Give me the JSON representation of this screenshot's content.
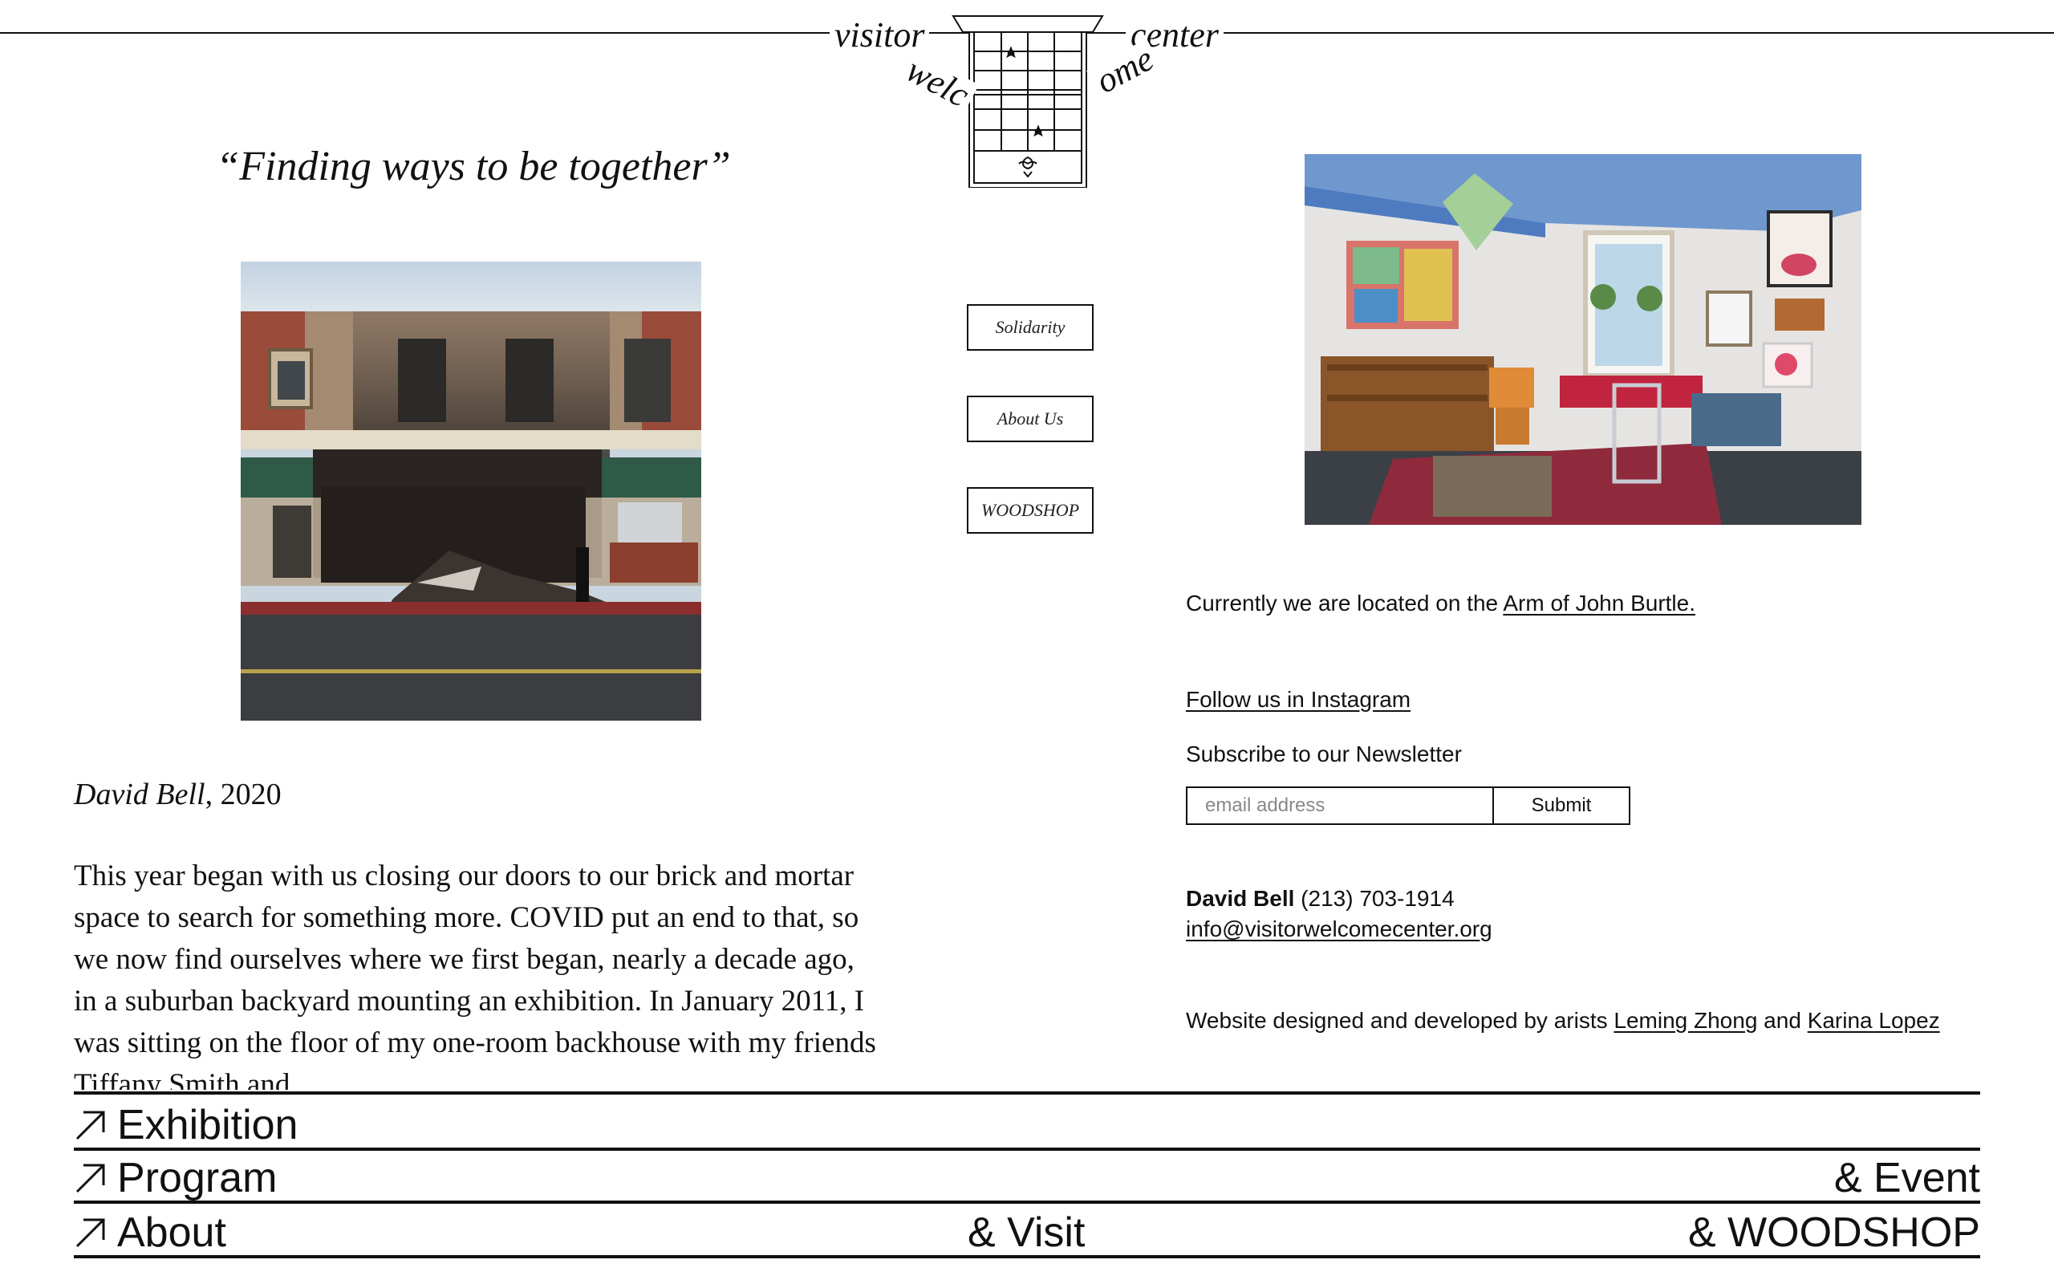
{
  "logo": {
    "word_visitor": "visitor",
    "word_welc": "welc",
    "word_ome": "ome",
    "word_center": "center"
  },
  "left": {
    "quote": "“Finding ways to be together”",
    "caption_name": "David Bell",
    "caption_year": ", 2020",
    "story": "This year began with us closing our doors to our brick and mortar space to search for something more. COVID put an end to that, so we now find ourselves where we first began, nearly a decade ago, in a suburban backyard mounting an exhibition. In January 2011, I was sitting on the floor of my one-room backhouse with my friends Tiffany Smith and"
  },
  "nav_buttons": {
    "solidarity": "Solidarity",
    "about_us": "About Us",
    "woodshop": "WOODSHOP"
  },
  "right": {
    "location_prefix": "Currently we are located on the ",
    "location_link": "Arm of John Burtle.",
    "instagram_link": "Follow us in Instagram",
    "subscribe_label": "Subscribe to our Newsletter",
    "email_placeholder": "email address",
    "submit_label": "Submit",
    "contact_name": "David Bell",
    "contact_phone": " (213) 703-1914",
    "contact_email": "info@visitorwelcomecenter.org",
    "credits_prefix": "Website designed and developed by arists ",
    "designer_1": "Leming Zhong",
    "credits_and": " and ",
    "designer_2": "Karina Lopez"
  },
  "bottom_nav": {
    "exhibition": "Exhibition",
    "program": "Program",
    "event": "& Event",
    "about": "About",
    "visit": "& Visit",
    "woodshop": "& WOODSHOP"
  },
  "icons": {
    "nav_arrow": "arrow-up-right-icon"
  }
}
